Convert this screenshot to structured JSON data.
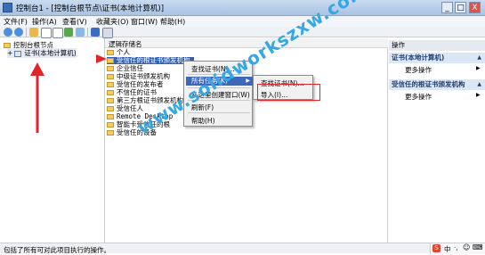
{
  "window": {
    "title": "控制台1 - [控制台根节点\\证书(本地计算机)]",
    "controls": [
      "_",
      "□",
      "X"
    ]
  },
  "menu": [
    "文件(F)",
    "操作(A)",
    "查看(V)",
    "收藏夹(O)",
    "窗口(W)",
    "帮助(H)"
  ],
  "toolbar_icons": [
    "back-icon",
    "forward-icon",
    "up-folder-icon",
    "show-hide-tree-icon",
    "properties-icon",
    "refresh-icon",
    "export-icon",
    "help-icon",
    "console-icon"
  ],
  "tree": {
    "root": "控制台根节点",
    "child": "证书(本地计算机)",
    "expander": "+"
  },
  "center": {
    "column_header": "逻辑存储名",
    "rows": [
      "个人",
      "受信任的根证书颁发机构",
      "企业信任",
      "中级证书颁发机构",
      "受信任的发布者",
      "不信任的证书",
      "第三方根证书颁发机构",
      "受信任人",
      "Remote Desktop",
      "智能卡受信任的根",
      "受信任的设备"
    ],
    "selected_index": 1
  },
  "context_menu": {
    "items": [
      "查找证书(N)...",
      "所有任务(K)",
      "从这里创建窗口(W)",
      "刷新(F)",
      "帮助(H)"
    ],
    "highlighted_index": 1,
    "submenu_arrow": "▶"
  },
  "submenu": {
    "items": [
      "查找证书(N)...",
      "导入(I)..."
    ]
  },
  "actions": {
    "header": "操作",
    "section1_title": "证书(本地计算机)",
    "section1_item": "更多操作",
    "section2_title": "受信任的根证书颁发机构",
    "section2_item": "更多操作",
    "arrow": "▲",
    "item_arrow": "▶"
  },
  "status": {
    "text": "包括了所有可对此项目执行的操作。"
  },
  "ime": {
    "items": [
      "S",
      "中",
      "·,",
      "☺",
      "⌨"
    ]
  },
  "watermark": "www.solidworkszxw.com",
  "colors": {
    "title_gradient": "#b9cfe9",
    "selection": "#3061b6",
    "highlight_box": "#e0262b",
    "watermark": "#35a7e4"
  }
}
